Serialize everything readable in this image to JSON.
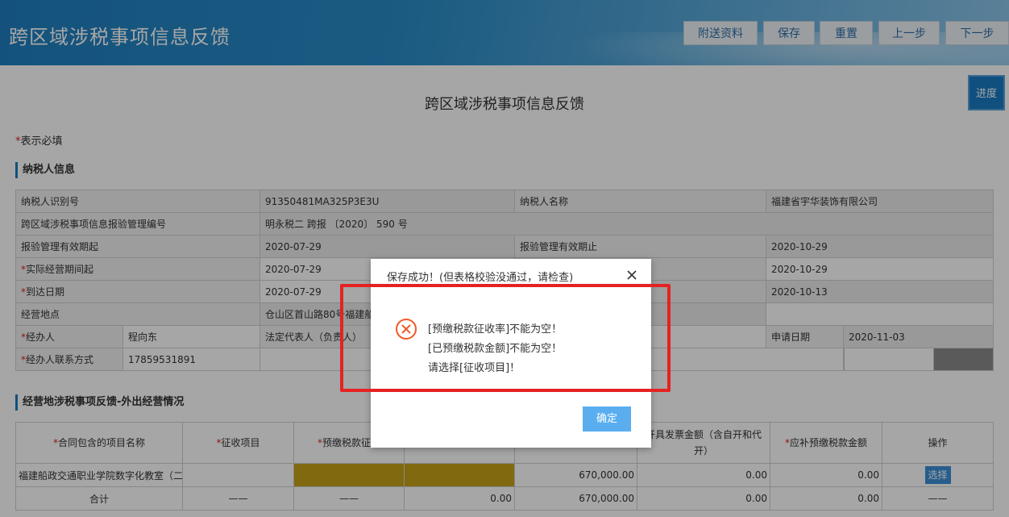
{
  "header": {
    "title": "跨区域涉税事项信息反馈",
    "buttons": [
      "附送资料",
      "保存",
      "重置",
      "上一步",
      "下一步"
    ]
  },
  "page": {
    "form_title": "跨区域涉税事项信息反馈",
    "progress_label": "进度",
    "required_star": "*",
    "required_note": "表示必填"
  },
  "taxpayer": {
    "section_title": "纳税人信息",
    "id_label": "纳税人识别号",
    "id_value": "91350481MA325P3E3U",
    "name_label": "纳税人名称",
    "name_value": "福建省宇华装饰有限公司",
    "mgmt_no_label": "跨区域涉税事项信息报验管理编号",
    "mgmt_no_value": "明永税二 跨报 〔2020〕 590 号",
    "valid_from_label": "报验管理有效期起",
    "valid_from_value": "2020-07-29",
    "valid_to_label": "报验管理有效期止",
    "valid_to_value": "2020-10-29",
    "actual_start_label": "实际经营期间起",
    "actual_start_value": "2020-07-29",
    "actual_end_value": "2020-10-29",
    "arrival_label": "到达日期",
    "arrival_value": "2020-07-29",
    "arrival_right_value": "2020-10-13",
    "address_label": "经营地点",
    "address_value": "仓山区首山路80号福建船政",
    "handler_label": "经办人",
    "handler_value": "程向东",
    "legal_rep_label": "法定代表人（负责人）",
    "apply_date_label": "申请日期",
    "apply_date_value": "2020-11-03",
    "contact_label": "经办人联系方式",
    "contact_value": "17859531891"
  },
  "operations": {
    "section_title": "经营地涉税事项反馈-外出经营情况",
    "headers": {
      "project": "合同包含的项目名称",
      "levy": "征收项目",
      "rate": "预缴税款征收",
      "invoice": "开具发票金额（含自开和代开）",
      "supplement": "应补预缴税款金额",
      "action": "操作"
    },
    "row": {
      "project": "福建船政交通职业学院数字化教室（二",
      "amount": "670,000.00",
      "invoice": "0.00",
      "supplement": "0.00",
      "action": "选择"
    },
    "total": {
      "label": "合计",
      "dash1": "——",
      "dash2": "——",
      "prepaid": "0.00",
      "amount": "670,000.00",
      "invoice": "0.00",
      "supplement": "0.00",
      "dash3": "——"
    }
  },
  "dialog": {
    "title": "保存成功！(但表格校验没通过，请检查)",
    "messages": [
      "[预缴税款征收率]不能为空！",
      "[已预缴税款金额]不能为空！",
      "请选择[征收项目]！"
    ],
    "ok_label": "确定"
  },
  "colors": {
    "header_blue": "#1f7fc0",
    "accent_blue": "#1a7bc4",
    "error_red": "#e52222",
    "gold_cell": "#c6a21a"
  }
}
